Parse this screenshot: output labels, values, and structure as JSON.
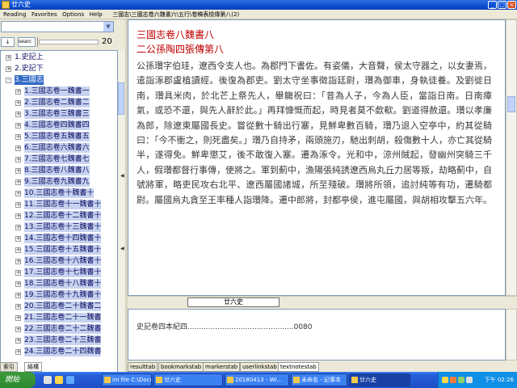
{
  "window": {
    "title": "廿六史"
  },
  "menu": {
    "items": [
      "Reading",
      "Favorites",
      "Options",
      "Help"
    ],
    "path": "三國志\\三國志卷六魏書六\\五行\\卷稿表檢傳第八(2)"
  },
  "left": {
    "combo_value": "",
    "search_button": "↓",
    "search_value": "searc",
    "result_count": "20",
    "tree": [
      {
        "exp": "+",
        "label": "1.史記上"
      },
      {
        "exp": "+",
        "label": "2.史記下"
      },
      {
        "exp": "-",
        "label": "3.三國志"
      },
      {
        "exp": "+",
        "label": "1.三國志卷一魏書一"
      },
      {
        "exp": "+",
        "label": "2.三國志卷二魏書二"
      },
      {
        "exp": "+",
        "label": "3.三國志卷三魏書三"
      },
      {
        "exp": "+",
        "label": "4.三國志卷四魏書四"
      },
      {
        "exp": "+",
        "label": "5.三國志卷五魏書五"
      },
      {
        "exp": "+",
        "label": "6.三國志卷六魏書六"
      },
      {
        "exp": "+",
        "label": "7.三國志卷七魏書七"
      },
      {
        "exp": "+",
        "label": "8.三國志卷八魏書八"
      },
      {
        "exp": "+",
        "label": "9.三國志卷九魏書九"
      },
      {
        "exp": "+",
        "label": "10.三國志卷十魏書十"
      },
      {
        "exp": "+",
        "label": "11.三國志卷十一魏書十"
      },
      {
        "exp": "+",
        "label": "12.三國志卷十二魏書十"
      },
      {
        "exp": "+",
        "label": "13.三國志卷十三魏書十"
      },
      {
        "exp": "+",
        "label": "14.三國志卷十四魏書十"
      },
      {
        "exp": "+",
        "label": "15.三國志卷十五魏書十"
      },
      {
        "exp": "+",
        "label": "16.三國志卷十六魏書十"
      },
      {
        "exp": "+",
        "label": "17.三國志卷十七魏書十"
      },
      {
        "exp": "+",
        "label": "18.三國志卷十八魏書十"
      },
      {
        "exp": "+",
        "label": "19.三國志卷十九魏書十"
      },
      {
        "exp": "+",
        "label": "20.三國志卷二十魏書二"
      },
      {
        "exp": "+",
        "label": "21.三國志卷二十一魏書"
      },
      {
        "exp": "+",
        "label": "22.三國志卷二十二魏書"
      },
      {
        "exp": "+",
        "label": "23.三國志卷二十三魏書"
      },
      {
        "exp": "+",
        "label": "24.三國志卷二十四魏書"
      }
    ],
    "tabs": [
      "索引",
      "結構"
    ]
  },
  "content": {
    "heading1": "三國志卷八魏書八",
    "heading2": "二公孫陶四張傳第八",
    "body": "公孫瓚字伯珪，遼西令支人也。為郡門下書佐。有姿儀，大音聲，侯太守器之，以女妻焉，遣詣涿郡盧植讀經。後復為郡吏。劉太守坐事徵詣廷尉，瓚為御車，身執徒養。及劉徙日南，瓚具米肉，於北芒上祭先人，舉觴祝曰：「昔為人子，今為人臣，當詣日南。日南瘴氣，或恐不還，與先人辭於此。」再拜慷慨而起，時見者莫不歔欷。劉道得赦還。瓚以孝廉為郎，除遼東屬國長史。嘗從數十騎出行塞，見鮮卑數百騎，瓚乃退入空亭中，約其從騎曰：「今不衝之，則死盡矣。」瓚乃自持矛，兩頭施刃，馳出刺胡，殺傷數十人，亦亡其從騎半，遂得免。鮮卑懲艾，後不敢復入塞。遷為涿令。光和中，涼州賊起，發幽州突騎三千人，假瓚都督行事傳，使將之。軍到薊中，漁陽張純誘遼西烏丸丘力居等叛，劫略薊中，自號將軍，略吏民攻右北平、遼西屬國諸城，所至殘破。瓚將所領，追討純等有功，遷騎都尉。屬國烏丸貪至王率種人詣瓚降。遷中郎將，封都亭侯，進屯屬國，與胡相攻擊五六年。"
  },
  "nav": {
    "button_label": "廿六史"
  },
  "results": {
    "row": "史記卷四本紀四..............................................0080"
  },
  "bottom_tabs": [
    "resulttab",
    "bookmarkstab",
    "markerstab",
    "userlinkstab",
    "textnotestab"
  ],
  "taskbar": {
    "start": "開始",
    "tasks": [
      "ini file C:\\Docu...",
      "廿六史",
      "20180413 - Wi...",
      "未命名 - 記事本",
      "廿六史"
    ],
    "clock": "下午 02:26"
  }
}
